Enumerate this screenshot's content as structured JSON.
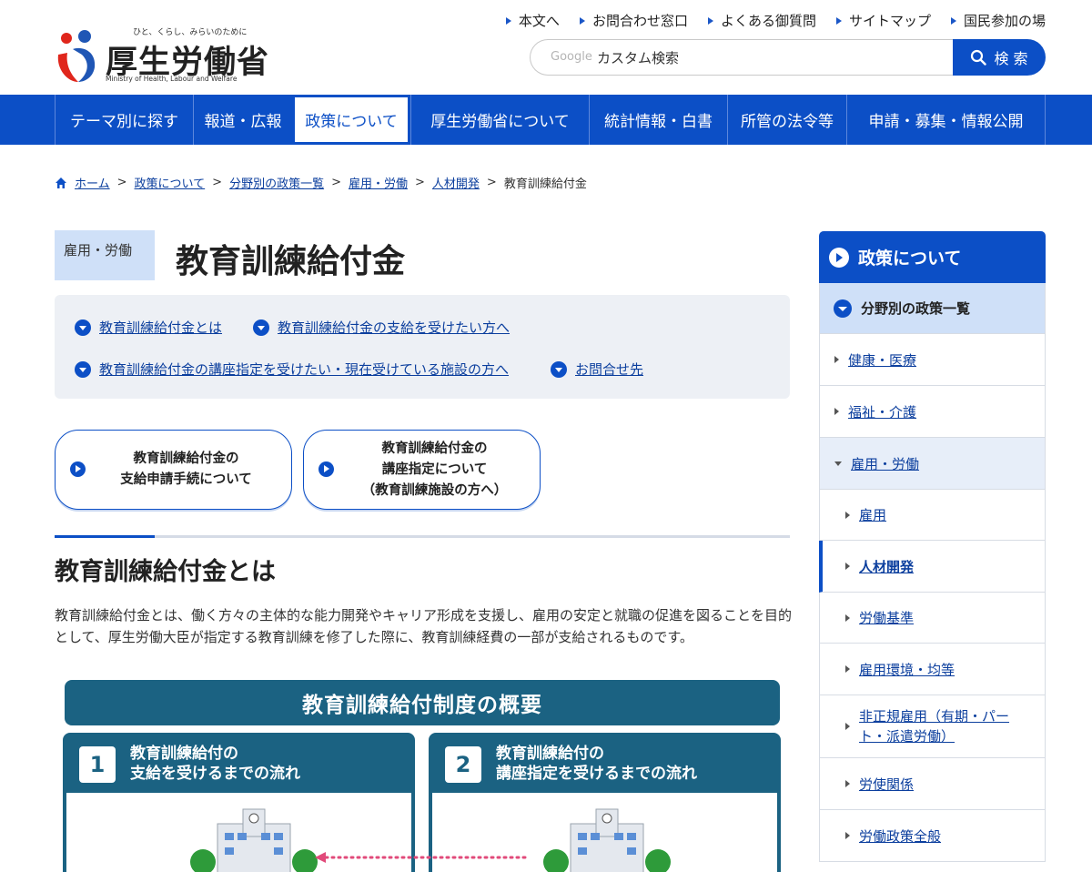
{
  "header": {
    "logo_tagline": "ひと、くらし、みらいのために",
    "logo_name": "厚生労働省",
    "logo_en": "Ministry of Health, Labour and Welfare",
    "utility_links": [
      "本文へ",
      "お問合わせ窓口",
      "よくある御質問",
      "サイトマップ",
      "国民参加の場"
    ],
    "search": {
      "brand": "Google",
      "placeholder": "カスタム検索",
      "button_label": "検 索"
    }
  },
  "nav": {
    "items": [
      "テーマ別に探す",
      "報道・広報",
      "政策について",
      "厚生労働省について",
      "統計情報・白書",
      "所管の法令等",
      "申請・募集・情報公開"
    ],
    "active": "政策について"
  },
  "breadcrumb": [
    "ホーム",
    "政策について",
    "分野別の政策一覧",
    "雇用・労働",
    "人材開発",
    "教育訓練給付金"
  ],
  "page": {
    "category": "雇用・労働",
    "title": "教育訓練給付金",
    "anchors": [
      "教育訓練給付金とは",
      "教育訓練給付金の支給を受けたい方へ",
      "教育訓練給付金の講座指定を受けたい・現在受けている施設の方へ",
      "お問合せ先"
    ],
    "cta": [
      {
        "lines": [
          "教育訓練給付金の",
          "支給申請手続について"
        ]
      },
      {
        "lines": [
          "教育訓練給付金の",
          "講座指定について",
          "（教育訓練施設の方へ）"
        ]
      }
    ],
    "section_heading": "教育訓練給付金とは",
    "section_body": "教育訓練給付金とは、働く方々の主体的な能力開発やキャリア形成を支援し、雇用の安定と就職の促進を図ることを目的として、厚生労働大臣が指定する教育訓練を修了した際に、教育訓練経費の一部が支給されるものです。",
    "diagram": {
      "title": "教育訓練給付制度の概要",
      "panels": [
        {
          "num": "1",
          "lines": [
            "教育訓練給付の",
            "支給を受けるまでの流れ"
          ]
        },
        {
          "num": "2",
          "lines": [
            "教育訓練給付の",
            "講座指定を受けるまでの流れ"
          ]
        }
      ]
    }
  },
  "sidebar": {
    "top": "政策について",
    "sub": "分野別の政策一覧",
    "items": [
      "健康・医療",
      "福祉・介護",
      "雇用・労働",
      "雇用",
      "人材開発",
      "労働基準",
      "雇用環境・均等",
      "非正規雇用（有期・パート・派遣労働）",
      "労使関係",
      "労働政策全般"
    ],
    "long_item_lines": [
      "非正規雇用（有期・パー",
      "ト・派遣労働）"
    ]
  },
  "colors": {
    "primary": "#0c4fc6",
    "diagram": "#1b6282",
    "badge_bg": "#cfe0f8",
    "anchor_bg": "#edf0f5"
  }
}
